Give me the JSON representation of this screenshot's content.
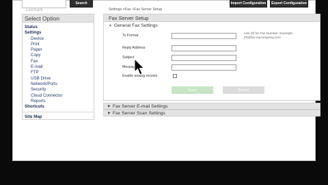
{
  "topbar": {
    "search_value": "",
    "logo_text": "Lexmark",
    "search_label": "Search",
    "import_label": "Import Configuration",
    "export_label": "Export Configuration"
  },
  "sidebar": {
    "title": "Select Option",
    "items": [
      {
        "label": "Status",
        "level": 0
      },
      {
        "label": "Settings",
        "level": 0
      },
      {
        "label": "Device",
        "level": 1
      },
      {
        "label": "Print",
        "level": 1
      },
      {
        "label": "Paper",
        "level": 1
      },
      {
        "label": "Copy",
        "level": 1
      },
      {
        "label": "Fax",
        "level": 1
      },
      {
        "label": "E-mail",
        "level": 1
      },
      {
        "label": "FTP",
        "level": 1
      },
      {
        "label": "USB Drive",
        "level": 1
      },
      {
        "label": "Network/Ports",
        "level": 1
      },
      {
        "label": "Security",
        "level": 1
      },
      {
        "label": "Cloud Connector",
        "level": 1
      },
      {
        "label": "Reports",
        "level": 1
      },
      {
        "label": "Shortcuts",
        "level": 0
      }
    ],
    "sitemap": "Site Map"
  },
  "breadcrumb": {
    "part1": "Settings",
    "sep1": " >",
    "part2": "Fax",
    "sep2": " >",
    "part3": "Fax Server Setup"
  },
  "panel": {
    "title": "Fax Server Setup",
    "section_title": "General Fax Settings",
    "fields": {
      "to_format": {
        "label": "To Format",
        "value": ""
      },
      "reply_address": {
        "label": "Reply Address",
        "value": ""
      },
      "subject": {
        "label": "Subject",
        "value": ""
      },
      "message": {
        "label": "Message",
        "value": ""
      }
    },
    "hint": "Use [#] for Fax Number. Example: [#]@fax.mycompany.com",
    "checkbox_label": "Enable analog receive",
    "save_label": "Save",
    "reset_label": "Reset"
  },
  "collapsed_sections": [
    {
      "label": "Fax Server E-mail Settings"
    },
    {
      "label": "Fax Server Scan Settings"
    }
  ],
  "icons": {
    "collapsed": "triangle-right-icon",
    "expanded": "triangle-down-icon",
    "pointer": "mouse-cursor-icon"
  }
}
